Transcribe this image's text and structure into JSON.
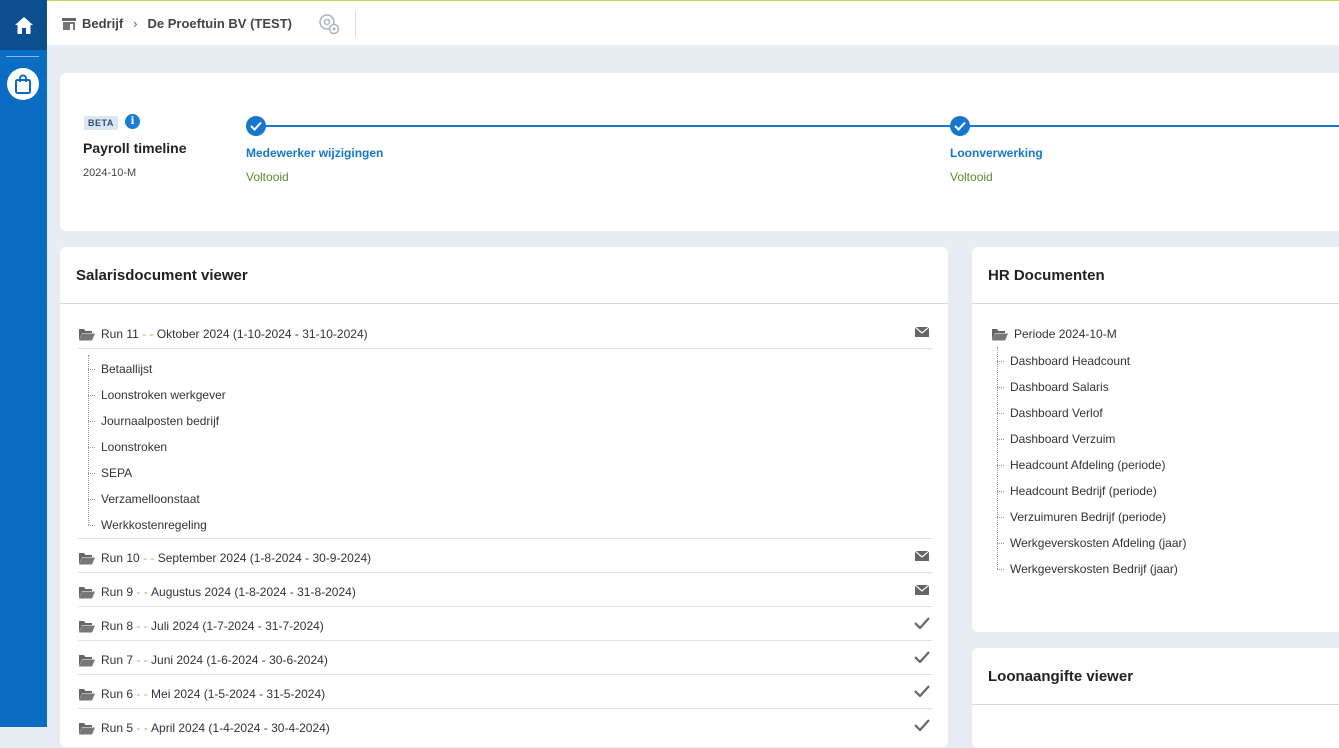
{
  "topbar": {
    "company_label": "Bedrijf",
    "company_name": "De Proeftuin BV (TEST)"
  },
  "timeline": {
    "badge": "BETA",
    "title": "Payroll timeline",
    "period": "2024-10-M",
    "steps": [
      {
        "label": "Medewerker wijzigingen",
        "status": "Voltooid"
      },
      {
        "label": "Loonverwerking",
        "status": "Voltooid"
      }
    ]
  },
  "salaris": {
    "title": "Salarisdocument viewer",
    "runs": [
      {
        "run": "Run 11",
        "sep": " - - ",
        "period": "Oktober 2024 (1-10-2024 - 31-10-2024)",
        "icon": "mail-icon"
      },
      {
        "run": "Run 10",
        "sep": " - - ",
        "period": "September 2024 (1-8-2024 - 30-9-2024)",
        "icon": "mail-icon"
      },
      {
        "run": "Run 9",
        "sep": " - - ",
        "period": "Augustus 2024 (1-8-2024 - 31-8-2024)",
        "icon": "mail-icon"
      },
      {
        "run": "Run 8",
        "sep": " - - ",
        "period": "Juli 2024 (1-7-2024 - 31-7-2024)",
        "icon": "check-icon"
      },
      {
        "run": "Run 7",
        "sep": " - - ",
        "period": "Juni 2024 (1-6-2024 - 30-6-2024)",
        "icon": "check-icon"
      },
      {
        "run": "Run 6",
        "sep": " - - ",
        "period": "Mei 2024 (1-5-2024 - 31-5-2024)",
        "icon": "check-icon"
      },
      {
        "run": "Run 5",
        "sep": " - - ",
        "period": "April 2024 (1-4-2024 - 30-4-2024)",
        "icon": "check-icon"
      }
    ],
    "documents": [
      "Betaallijst",
      "Loonstroken werkgever",
      "Journaalposten bedrijf",
      "Loonstroken",
      "SEPA",
      "Verzamelloonstaat",
      "Werkkostenregeling"
    ]
  },
  "hr": {
    "title": "HR Documenten",
    "folder": "Periode 2024-10-M",
    "items": [
      "Dashboard Headcount",
      "Dashboard Salaris",
      "Dashboard Verlof",
      "Dashboard Verzuim",
      "Headcount Afdeling (periode)",
      "Headcount Bedrijf (periode)",
      "Verzuimuren Bedrijf (periode)",
      "Werkgeverskosten Afdeling (jaar)",
      "Werkgeverskosten Bedrijf (jaar)"
    ]
  },
  "loonaangifte": {
    "title": "Loonaangifte viewer"
  },
  "colors": {
    "accent": "#1677cc",
    "rail": "#0a6cc2",
    "rail_active": "#0b4f8e",
    "status_done": "#5d8a2c"
  }
}
